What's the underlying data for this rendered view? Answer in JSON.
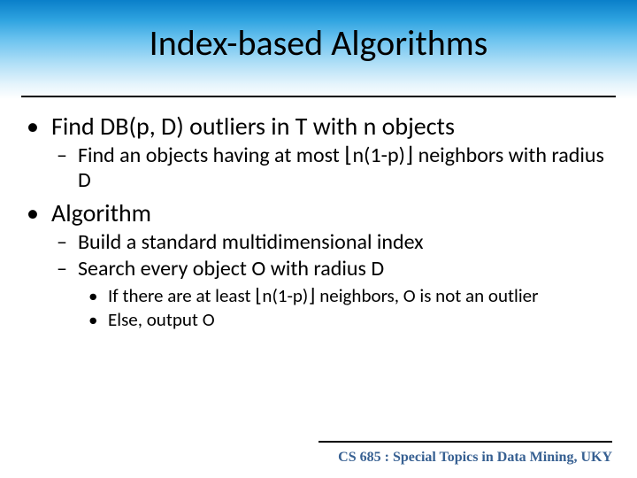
{
  "title": "Index-based Algorithms",
  "bullets": {
    "b1": "Find DB(p, D) outliers in T with n objects",
    "b1a": "Find an objects having at most ⌊n(1-p)⌋ neighbors with radius D",
    "b2": "Algorithm",
    "b2a": "Build a standard multidimensional index",
    "b2b": "Search every object O with radius D",
    "b2b1": "If there are at least ⌊n(1-p)⌋ neighbors, O is not an outlier",
    "b2b2": "Else, output O"
  },
  "footer": "CS 685 : Special Topics in Data Mining, UKY",
  "glyphs": {
    "dot": "•",
    "dash": "–"
  }
}
